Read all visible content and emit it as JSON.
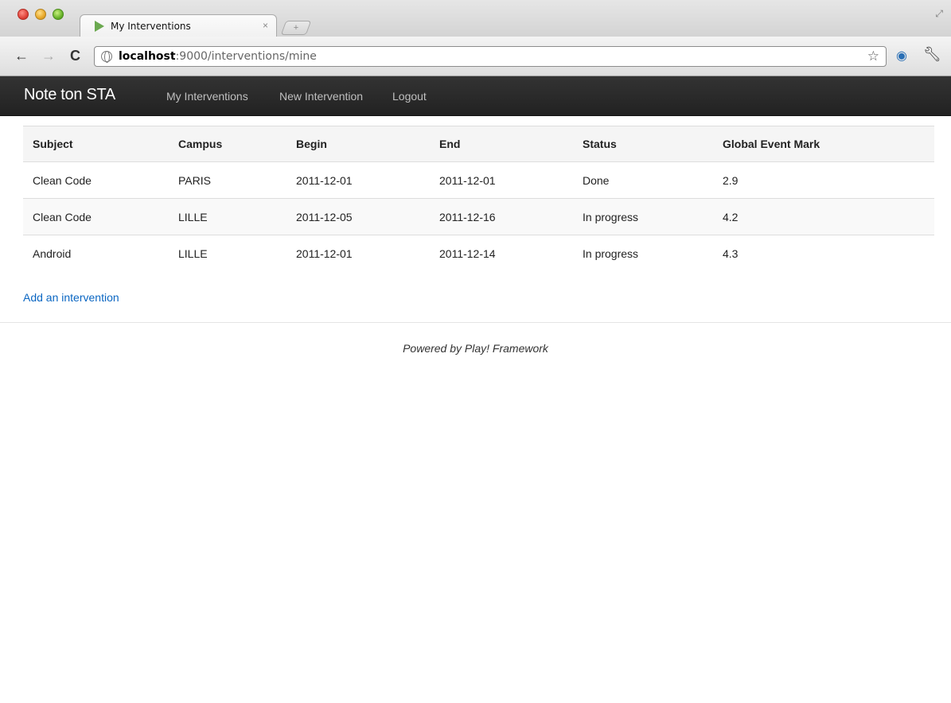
{
  "browser": {
    "tab_title": "My Interventions",
    "tab_close": "×",
    "new_tab": "+",
    "url_host": "localhost",
    "url_rest": ":9000/interventions/mine"
  },
  "navbar": {
    "brand": "Note ton STA",
    "links": [
      "My Interventions",
      "New Intervention",
      "Logout"
    ]
  },
  "table": {
    "headers": [
      "Subject",
      "Campus",
      "Begin",
      "End",
      "Status",
      "Global Event Mark"
    ],
    "rows": [
      [
        "Clean Code",
        "PARIS",
        "2011-12-01",
        "2011-12-01",
        "Done",
        "2.9"
      ],
      [
        "Clean Code",
        "LILLE",
        "2011-12-05",
        "2011-12-16",
        "In progress",
        "4.2"
      ],
      [
        "Android",
        "LILLE",
        "2011-12-01",
        "2011-12-14",
        "In progress",
        "4.3"
      ]
    ]
  },
  "add_link": "Add an intervention",
  "footer": "Powered by Play! Framework",
  "icons": {
    "back": "back-arrow-icon",
    "forward": "forward-arrow-icon",
    "reload": "reload-icon",
    "bookmark": "star-icon",
    "extension": "globe-extension-icon",
    "menu": "wrench-icon"
  },
  "colors": {
    "navbar_bg": "#222222",
    "link": "#0a66c2"
  }
}
